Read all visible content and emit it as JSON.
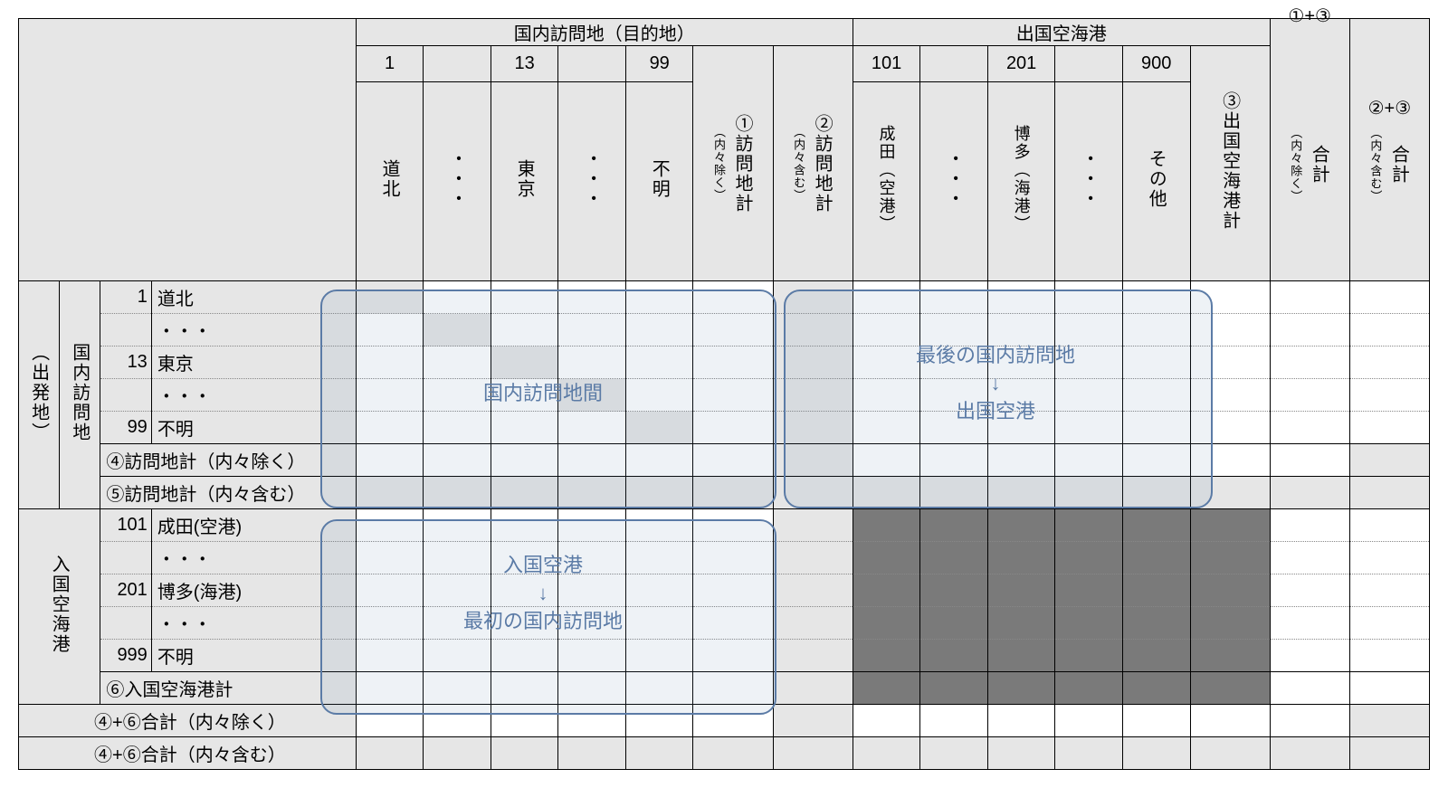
{
  "header": {
    "group_domestic": "国内訪問地（目的地）",
    "group_departure": "出国空海港",
    "col_nums": [
      "1",
      "13",
      "99",
      "101",
      "201",
      "900"
    ],
    "col_names": {
      "douhoku": "道北",
      "dots": "・・・",
      "tokyo": "東京",
      "fumei": "不明",
      "narita": "成田（空港）",
      "hakata": "博多（海港）",
      "other": "その他"
    },
    "sum1": "①訪問地計",
    "sum1_sub": "（内々除く）",
    "sum2": "②訪問地計",
    "sum2_sub": "（内々含む）",
    "sum3": "③出国空海港計",
    "total_a": "①+③",
    "total_a_main": "合計",
    "total_a_sub": "（内々除く）",
    "total_b": "②+③",
    "total_b_main": "合計",
    "total_b_sub": "（内々含む）"
  },
  "side": {
    "group1_outer": "（出発地）",
    "group1_inner": "国内訪問地",
    "group2": "入国空海港"
  },
  "rows": {
    "r1_num": "1",
    "r1_name": "道北",
    "r2_name": "・・・",
    "r3_num": "13",
    "r3_name": "東京",
    "r4_name": "・・・",
    "r5_num": "99",
    "r5_name": "不明",
    "r6_name": "④訪問地計（内々除く）",
    "r7_name": "⑤訪問地計（内々含む）",
    "r8_num": "101",
    "r8_name": "成田(空港)",
    "r9_name": "・・・",
    "r10_num": "201",
    "r10_name": "博多(海港)",
    "r11_name": "・・・",
    "r12_num": "999",
    "r12_name": "不明",
    "r13_name": "⑥入国空海港計",
    "r14_name": "④+⑥合計（内々除く）",
    "r15_name": "④+⑥合計（内々含む）"
  },
  "annotations": {
    "box1": "国内訪問地間",
    "box2_line1": "最後の国内訪問地",
    "box2_arrow": "↓",
    "box2_line2": "出国空港",
    "box3_line1": "入国空港",
    "box3_arrow": "↓",
    "box3_line2": "最初の国内訪問地"
  }
}
